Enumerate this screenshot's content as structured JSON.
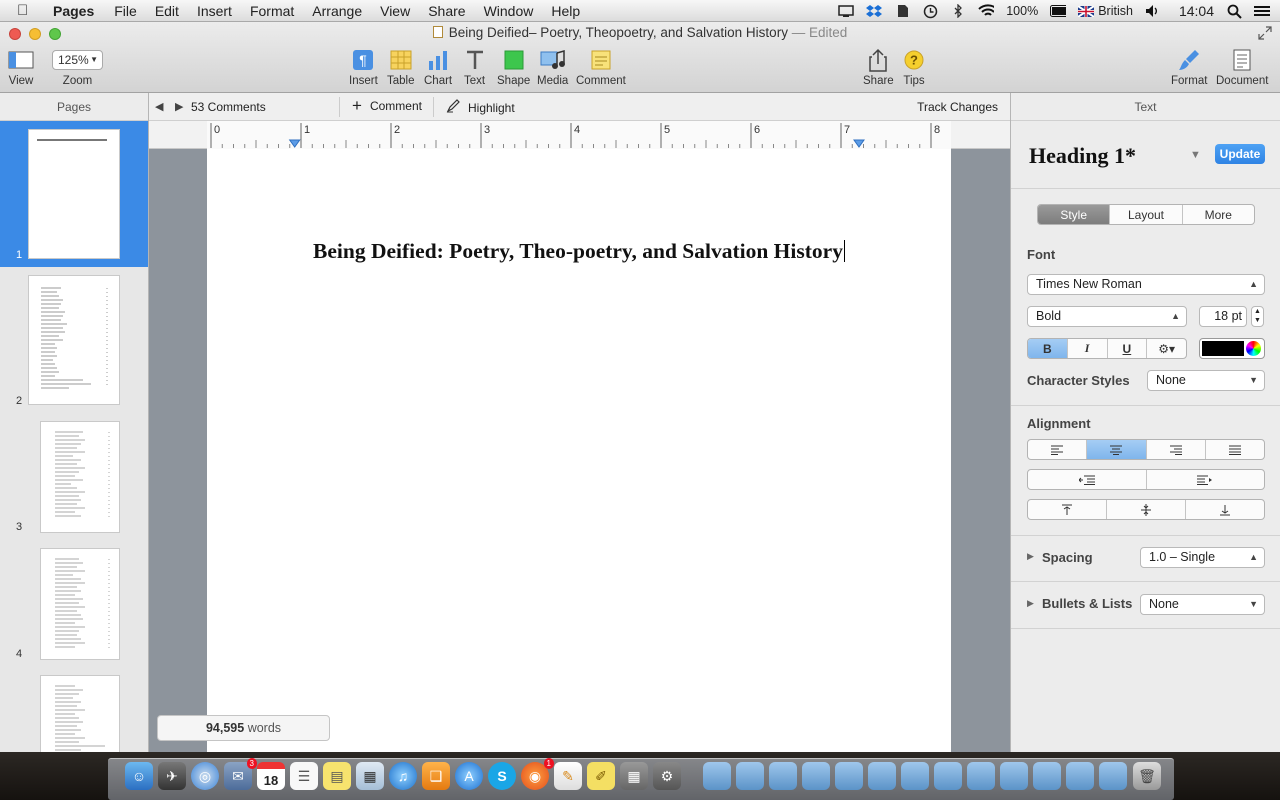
{
  "menubar": {
    "app": "Pages",
    "items": [
      "File",
      "Edit",
      "Insert",
      "Format",
      "Arrange",
      "View",
      "Share",
      "Window",
      "Help"
    ],
    "status": {
      "battery": "100%",
      "input_source": "British",
      "time": "14:04"
    }
  },
  "window": {
    "title": "Being Deified– Poetry, Theopoetry, and Salvation History",
    "edited": "— Edited",
    "zoom_value": "125%",
    "toolbar": {
      "view": "View",
      "zoom": "Zoom",
      "insert": "Insert",
      "table": "Table",
      "chart": "Chart",
      "text": "Text",
      "shape": "Shape",
      "media": "Media",
      "comment": "Comment",
      "share": "Share",
      "tips": "Tips",
      "format": "Format",
      "document": "Document"
    }
  },
  "pages_panel": {
    "title": "Pages",
    "pages": [
      "1",
      "2",
      "3",
      "4"
    ]
  },
  "comment_bar": {
    "count": "53 Comments",
    "comment": "Comment",
    "highlight": "Highlight",
    "track_changes": "Track Changes"
  },
  "ruler": {
    "marks": [
      "0",
      "1",
      "2",
      "3",
      "4",
      "5",
      "6",
      "7",
      "8"
    ]
  },
  "document": {
    "heading": "Being Deified: Poetry, Theo-poetry, and Salvation History"
  },
  "word_count": {
    "count": "94,595",
    "label": "words"
  },
  "inspector": {
    "title": "Text",
    "style_name": "Heading 1*",
    "update": "Update",
    "tabs": [
      "Style",
      "Layout",
      "More"
    ],
    "font_label": "Font",
    "font_family": "Times New Roman",
    "typeface": "Bold",
    "font_size": "18 pt",
    "fmt": {
      "bold": "B",
      "italic": "I",
      "underline": "U"
    },
    "char_styles_label": "Character Styles",
    "char_styles_value": "None",
    "alignment_label": "Alignment",
    "spacing_label": "Spacing",
    "spacing_value": "1.0 – Single",
    "bullets_label": "Bullets & Lists",
    "bullets_value": "None"
  },
  "dock": {
    "calendar_day": "18",
    "app_store_badge": "3",
    "notif_badge": "1"
  },
  "colors": {
    "selection": "#3b8ae6",
    "accent": "#2f7fe0",
    "text_color_swatch": "#000000"
  }
}
